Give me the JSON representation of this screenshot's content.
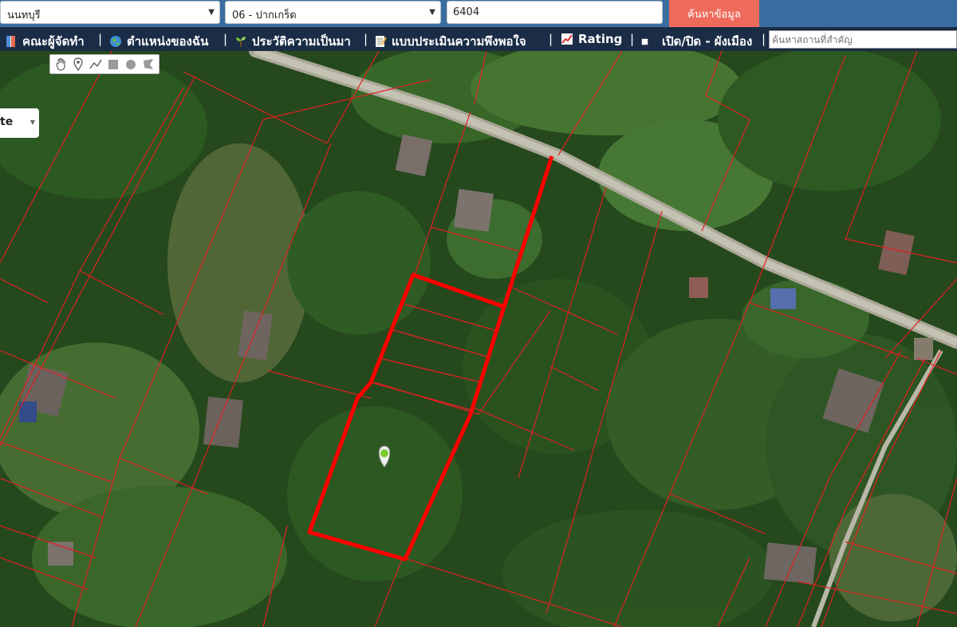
{
  "search": {
    "province": "นนทบุรี",
    "district": "06 - ปากเกร็ด",
    "parcel_number": "6404",
    "button_label": "ค้นหาข้อมูล"
  },
  "menu": {
    "items": [
      {
        "label": "คณะผู้จัดทำ",
        "icon": "book-icon"
      },
      {
        "label": "ตำแหน่งของฉัน",
        "icon": "globe-icon"
      },
      {
        "label": "ประวัติความเป็นมา",
        "icon": "sprout-icon"
      },
      {
        "label": "แบบประเมินความพึงพอใจ",
        "icon": "memo-icon"
      },
      {
        "label": "Rating",
        "icon": "chart-icon"
      },
      {
        "label": "เปิด/ปิด - ผังเมือง",
        "icon": "checkbox-icon"
      }
    ],
    "separator": "|",
    "place_search_placeholder": "ค้นหาสถานที่สำคัญ"
  },
  "map": {
    "layer_select": "te",
    "tools": [
      "hand-icon",
      "marker-icon",
      "polyline-icon",
      "rectangle-icon",
      "circle-icon",
      "polygon-icon"
    ],
    "colors": {
      "parcel_line": "#e02020",
      "highlight_parcel": "#ff0000",
      "road": "#b7b5a6",
      "marker": "#7ccb2e"
    }
  }
}
